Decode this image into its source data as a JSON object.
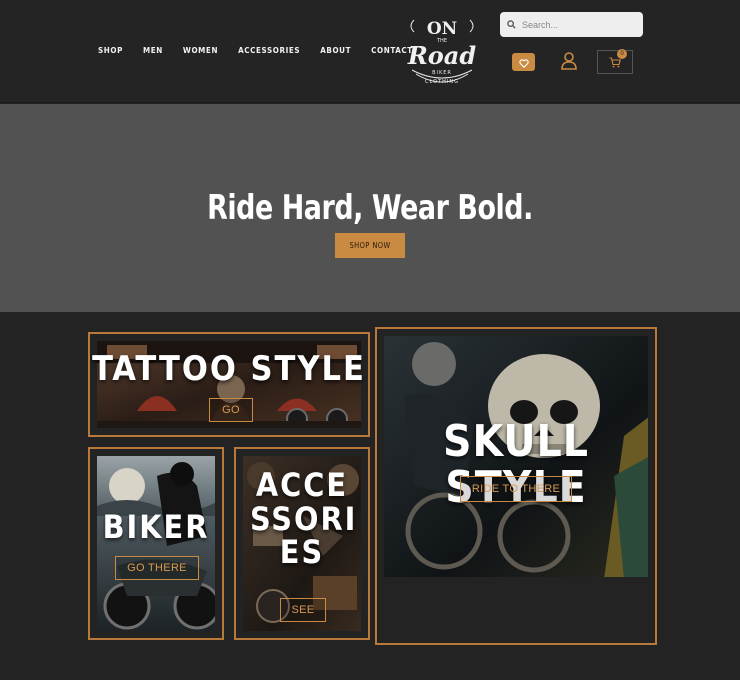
{
  "nav": {
    "items": [
      "SHOP",
      "MEN",
      "WOMEN",
      "ACCESSORIES",
      "ABOUT",
      "CONTACT"
    ]
  },
  "logo": {
    "line1": "ON",
    "line2": "THE",
    "line3": "ROAD",
    "line4": "BIKER",
    "line5": "CLOTHING"
  },
  "search": {
    "placeholder": "Search..."
  },
  "cart": {
    "count": "0"
  },
  "hero": {
    "title": "Ride Hard, Wear Bold.",
    "button": "SHOP NOW"
  },
  "tiles": {
    "tattoo": {
      "title": "TATTOO STYLE",
      "button": "GO"
    },
    "biker": {
      "title": "BIKER",
      "button": "GO THERE"
    },
    "accessories": {
      "title": "ACCE SSORI ES",
      "button": "SEE"
    },
    "skull": {
      "title": "SKULL STYLE",
      "button": "RIDE TO THERE"
    }
  },
  "colors": {
    "accent": "#c98a42",
    "header_bg": "#242424",
    "hero_bg": "#525252",
    "page_bg": "#232323"
  }
}
